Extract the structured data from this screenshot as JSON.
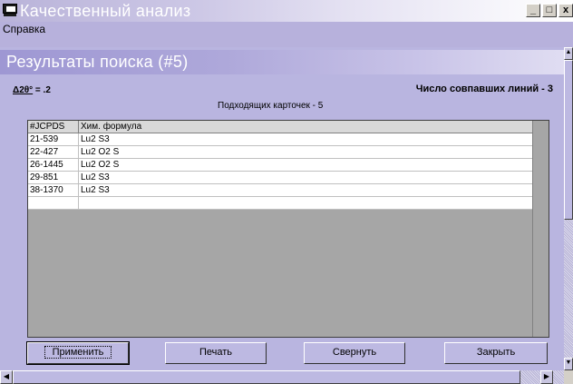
{
  "window": {
    "title": "Качественный анализ",
    "minimize_label": "_",
    "maximize_label": "□",
    "close_label": "x",
    "app_icon": "monitor-icon"
  },
  "menu": {
    "items": [
      {
        "label": "Справка"
      }
    ]
  },
  "results": {
    "title": "Результаты поиска (#5)",
    "delta_prefix": "Δ2θ°",
    "delta_value": " = .2",
    "match_lines": "Число совпавших линий - 3",
    "cards_count": "Подходящих карточек - 5"
  },
  "table": {
    "columns": [
      "#JCPDS",
      "Хим. формула"
    ],
    "rows": [
      [
        "21-539",
        "Lu2 S3"
      ],
      [
        "22-427",
        "Lu2 O2 S"
      ],
      [
        "26-1445",
        "Lu2 O2 S"
      ],
      [
        "29-851",
        "Lu2 S3"
      ],
      [
        "38-1370",
        "Lu2 S3"
      ],
      [
        "",
        ""
      ]
    ]
  },
  "buttons": {
    "apply": "Применить",
    "print": "Печать",
    "collapse": "Свернуть",
    "close": "Закрыть"
  },
  "scrollbars": {
    "up_arrow": "▲",
    "down_arrow": "▼",
    "left_arrow": "◀",
    "right_arrow": "▶"
  },
  "colors": {
    "titlebar_start": "#b9b3d9",
    "child_bg": "#b9b5e0",
    "grid_bg": "#a6a6a6"
  }
}
